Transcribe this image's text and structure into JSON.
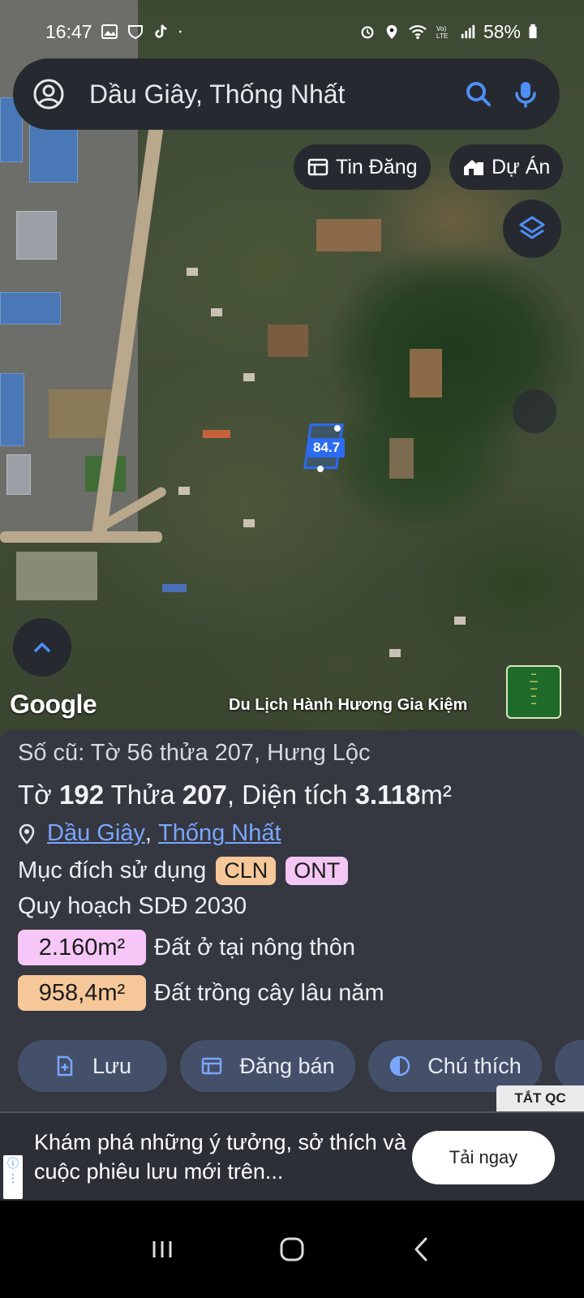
{
  "status_bar": {
    "time": "16:47",
    "battery": "58%",
    "left_icons": [
      "gallery-icon",
      "shield-icon",
      "tiktok-icon",
      "dot-icon"
    ],
    "right_icons": [
      "alarm-icon",
      "location-icon",
      "wifi-icon",
      "volte-icon",
      "signal-icon",
      "battery-icon"
    ]
  },
  "search": {
    "value": "Dầu Giây, Thống Nhất",
    "icons": [
      "account-icon",
      "search-icon",
      "mic-icon"
    ]
  },
  "chips": {
    "listings_label": "Tin Đăng",
    "projects_label": "Dự Án"
  },
  "map": {
    "parcel_label": "84.7",
    "google_logo": "Google",
    "caption": "Du Lịch Hành Hương Gia Kiệm"
  },
  "parcel": {
    "old_info": "Số cũ: Tờ 56 thửa 207, Hưng Lộc",
    "to_label": "Tờ",
    "to_value": "192",
    "thua_label": "Thửa",
    "thua_value": "207",
    "area_label": ", Diện tích",
    "area_value": "3.118",
    "area_unit": "m²",
    "location": [
      "Dầu Giây",
      "Thống Nhất"
    ],
    "location_sep": ",",
    "purpose_label": "Mục đích sử dụng",
    "purpose_badges": [
      {
        "code": "CLN",
        "color": "#f6c899"
      },
      {
        "code": "ONT",
        "color": "#f3c6f3"
      }
    ],
    "plan_label": "Quy hoạch SDĐ 2030",
    "zones": [
      {
        "value": "2.160m²",
        "label": "Đất ở tại nông thôn",
        "color": "#f6c6f6"
      },
      {
        "value": "958,4m²",
        "label": "Đất trồng cây lâu năm",
        "color": "#f6c899"
      }
    ]
  },
  "actions": {
    "save": "Lưu",
    "post_sale": "Đăng bán",
    "legend": "Chú thích"
  },
  "ad": {
    "off_label": "TẮT QC",
    "text": "Khám phá những ý tưởng, sở thích và cuộc phiêu lưu mới trên...",
    "cta": "Tải ngay"
  }
}
